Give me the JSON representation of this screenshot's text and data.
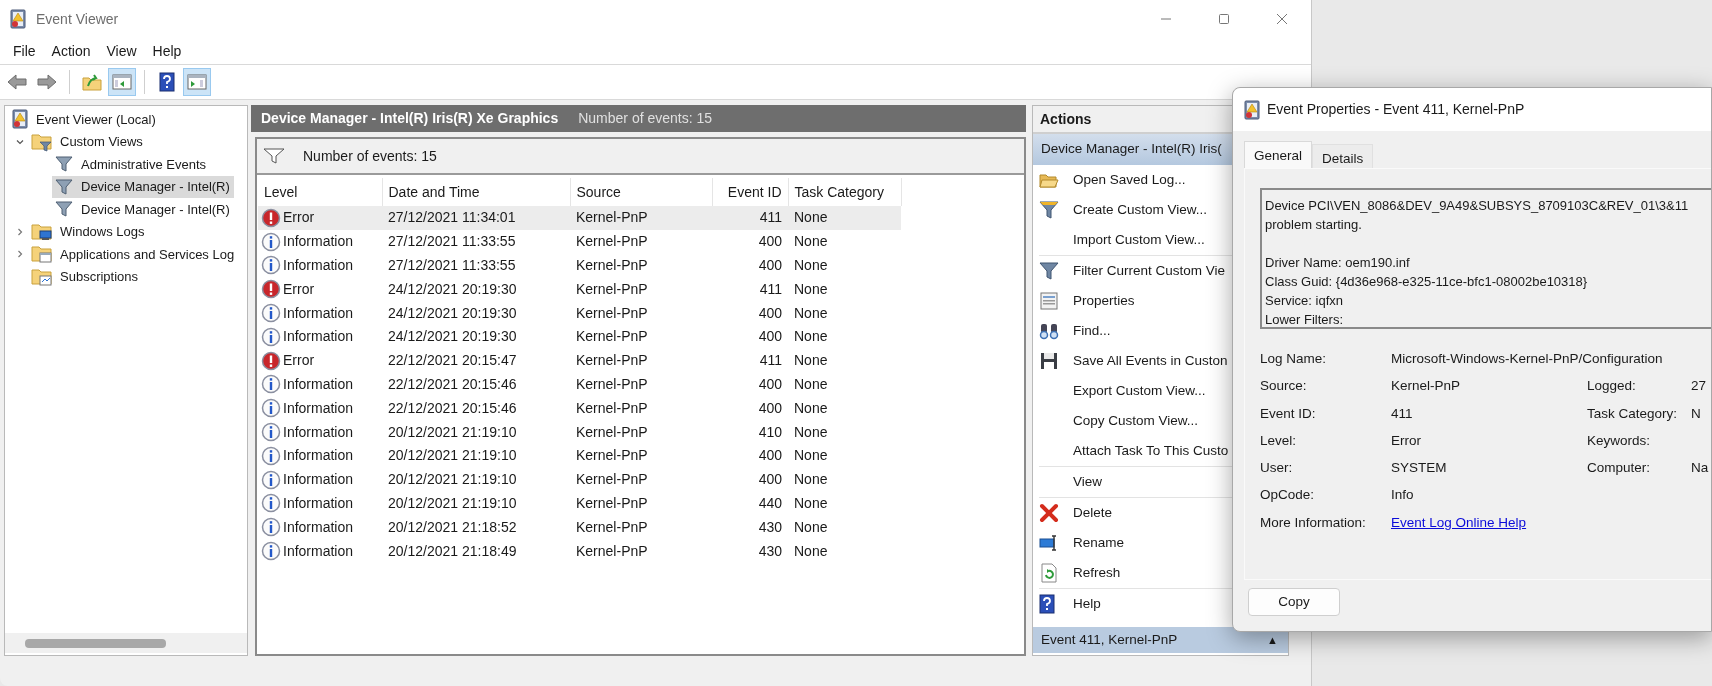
{
  "window": {
    "title": "Event Viewer"
  },
  "menu": [
    "File",
    "Action",
    "View",
    "Help"
  ],
  "toolbar": [
    {
      "kind": "back",
      "on": false
    },
    {
      "kind": "forward",
      "on": false
    },
    {
      "kind": "separator"
    },
    {
      "kind": "up",
      "on": false
    },
    {
      "kind": "tree",
      "on": true
    },
    {
      "kind": "separator"
    },
    {
      "kind": "help",
      "on": false
    },
    {
      "kind": "actions",
      "on": true
    }
  ],
  "tree": [
    {
      "label": "Event Viewer (Local)",
      "kind": "log",
      "selected": false,
      "children": [
        {
          "label": "Custom Views",
          "kind": "filter-folder",
          "expanded": true,
          "selected": false,
          "children": [
            {
              "label": "Administrative Events",
              "kind": "filter",
              "selected": false
            },
            {
              "label": "Device Manager - Intel(R)",
              "kind": "filter",
              "selected": true
            },
            {
              "label": "Device Manager - Intel(R)",
              "kind": "filter",
              "selected": false
            }
          ]
        },
        {
          "label": "Windows Logs",
          "kind": "log-folder",
          "expanded": false,
          "selected": false
        },
        {
          "label": "Applications and Services Log",
          "kind": "app-folder",
          "expanded": false,
          "selected": false
        },
        {
          "label": "Subscriptions",
          "kind": "sub-folder",
          "selected": false
        }
      ]
    }
  ],
  "center": {
    "title": "Device Manager - Intel(R) Iris(R) Xe Graphics",
    "count": "Number of events: 15",
    "filter_count": "Number of events: 15"
  },
  "table": {
    "columns": [
      "Level",
      "Date and Time",
      "Source",
      "Event ID",
      "Task Category"
    ],
    "rows": [
      {
        "kind": "error",
        "level": "Error",
        "date": "27/12/2021 11:34:01",
        "source": "Kernel-PnP",
        "event_id": "411",
        "category": "None",
        "selected": true
      },
      {
        "kind": "info",
        "level": "Information",
        "date": "27/12/2021 11:33:55",
        "source": "Kernel-PnP",
        "event_id": "400",
        "category": "None",
        "selected": false
      },
      {
        "kind": "info",
        "level": "Information",
        "date": "27/12/2021 11:33:55",
        "source": "Kernel-PnP",
        "event_id": "400",
        "category": "None",
        "selected": false
      },
      {
        "kind": "error",
        "level": "Error",
        "date": "24/12/2021 20:19:30",
        "source": "Kernel-PnP",
        "event_id": "411",
        "category": "None",
        "selected": false
      },
      {
        "kind": "info",
        "level": "Information",
        "date": "24/12/2021 20:19:30",
        "source": "Kernel-PnP",
        "event_id": "400",
        "category": "None",
        "selected": false
      },
      {
        "kind": "info",
        "level": "Information",
        "date": "24/12/2021 20:19:30",
        "source": "Kernel-PnP",
        "event_id": "400",
        "category": "None",
        "selected": false
      },
      {
        "kind": "error",
        "level": "Error",
        "date": "22/12/2021 20:15:47",
        "source": "Kernel-PnP",
        "event_id": "411",
        "category": "None",
        "selected": false
      },
      {
        "kind": "info",
        "level": "Information",
        "date": "22/12/2021 20:15:46",
        "source": "Kernel-PnP",
        "event_id": "400",
        "category": "None",
        "selected": false
      },
      {
        "kind": "info",
        "level": "Information",
        "date": "22/12/2021 20:15:46",
        "source": "Kernel-PnP",
        "event_id": "400",
        "category": "None",
        "selected": false
      },
      {
        "kind": "info",
        "level": "Information",
        "date": "20/12/2021 21:19:10",
        "source": "Kernel-PnP",
        "event_id": "410",
        "category": "None",
        "selected": false
      },
      {
        "kind": "info",
        "level": "Information",
        "date": "20/12/2021 21:19:10",
        "source": "Kernel-PnP",
        "event_id": "400",
        "category": "None",
        "selected": false
      },
      {
        "kind": "info",
        "level": "Information",
        "date": "20/12/2021 21:19:10",
        "source": "Kernel-PnP",
        "event_id": "400",
        "category": "None",
        "selected": false
      },
      {
        "kind": "info",
        "level": "Information",
        "date": "20/12/2021 21:19:10",
        "source": "Kernel-PnP",
        "event_id": "440",
        "category": "None",
        "selected": false
      },
      {
        "kind": "info",
        "level": "Information",
        "date": "20/12/2021 21:18:52",
        "source": "Kernel-PnP",
        "event_id": "430",
        "category": "None",
        "selected": false
      },
      {
        "kind": "info",
        "level": "Information",
        "date": "20/12/2021 21:18:49",
        "source": "Kernel-PnP",
        "event_id": "430",
        "category": "None",
        "selected": false
      }
    ]
  },
  "actions": {
    "title": "Actions",
    "section": "Device Manager - Intel(R) Iris(",
    "groups": [
      [
        {
          "kind": "open",
          "label": "Open Saved Log..."
        },
        {
          "kind": "create",
          "label": "Create Custom View..."
        },
        {
          "kind": "plain",
          "label": "Import Custom View..."
        }
      ],
      [
        {
          "kind": "filter",
          "label": "Filter Current Custom Vie"
        },
        {
          "kind": "properties",
          "label": "Properties"
        },
        {
          "kind": "find",
          "label": "Find..."
        },
        {
          "kind": "save",
          "label": "Save All Events in Custon"
        },
        {
          "kind": "plain",
          "label": "Export Custom View..."
        },
        {
          "kind": "plain",
          "label": "Copy Custom View..."
        },
        {
          "kind": "plain",
          "label": "Attach Task To This Custo"
        }
      ],
      [
        {
          "kind": "plain",
          "label": "View"
        }
      ],
      [
        {
          "kind": "delete",
          "label": "Delete"
        },
        {
          "kind": "rename",
          "label": "Rename"
        },
        {
          "kind": "refresh",
          "label": "Refresh"
        }
      ],
      [
        {
          "kind": "help",
          "label": "Help"
        }
      ]
    ],
    "footer": "Event 411, Kernel-PnP",
    "footer_glyph": "▲"
  },
  "dialog": {
    "title": "Event Properties - Event 411, Kernel-PnP",
    "tabs": [
      {
        "label": "General",
        "selected": true
      },
      {
        "label": "Details",
        "selected": false
      }
    ],
    "description": [
      [
        "Device PCI\\VEN_8086&DEV_9A49&SUBSYS_8709103C&REV_01\\3&11",
        "problem starting."
      ],
      [
        "Driver Name: oem190.inf",
        "Class Guid: {4d36e968-e325-11ce-bfc1-08002be10318}",
        "Service: iqfxn",
        "Lower Filters:"
      ]
    ],
    "log_name": {
      "label": "Log Name:",
      "value": "Microsoft-Windows-Kernel-PnP/Configuration"
    },
    "fields": [
      {
        "label": "Source:",
        "value": "Kernel-PnP"
      },
      {
        "label": "Event ID:",
        "value": "411"
      },
      {
        "label": "Level:",
        "value": "Error"
      },
      {
        "label": "User:",
        "value": "SYSTEM"
      },
      {
        "label": "OpCode:",
        "value": "Info"
      }
    ],
    "side_fields": [
      {
        "label": "Logged:",
        "value": "27"
      },
      {
        "label": "Task Category:",
        "value": "N"
      },
      {
        "label": "Keywords:"
      },
      {
        "label": "Computer:",
        "value": "Na"
      }
    ],
    "more_information": {
      "label": "More Information:",
      "link": "Event Log Online Help"
    },
    "buttons": [
      "Copy"
    ]
  }
}
